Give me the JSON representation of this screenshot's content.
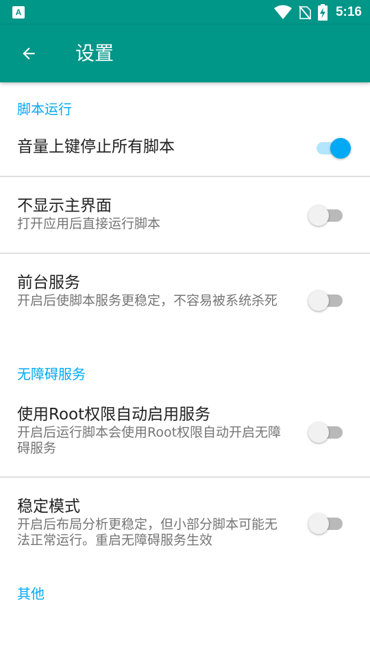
{
  "status_bar": {
    "app_icon_text": "A",
    "time": "5:16",
    "icons": [
      "wifi-icon",
      "no-sim-icon",
      "battery-charging-icon"
    ]
  },
  "app_bar": {
    "back_icon": "arrow-back-icon",
    "title": "设置"
  },
  "categories": {
    "script_run": "脚本运行",
    "accessibility": "无障碍服务",
    "other": "其他"
  },
  "prefs": {
    "volume_stop": {
      "title": "音量上键停止所有脚本",
      "enabled": true
    },
    "hide_main": {
      "title": "不显示主界面",
      "summary": "打开应用后直接运行脚本",
      "enabled": false
    },
    "foreground": {
      "title": "前台服务",
      "summary": "开启后使脚本服务更稳定，不容易被系统杀死",
      "enabled": false
    },
    "root_auto": {
      "title": "使用Root权限自动启用服务",
      "summary": "开启后运行脚本会使用Root权限自动开启无障碍服务",
      "enabled": false
    },
    "stable_mode": {
      "title": "稳定模式",
      "summary": "开启后布局分析更稳定，但小部分脚本可能无法正常运行。重启无障碍服务生效",
      "enabled": false
    }
  },
  "colors": {
    "primary": "#009688",
    "accent": "#03a9f4"
  }
}
